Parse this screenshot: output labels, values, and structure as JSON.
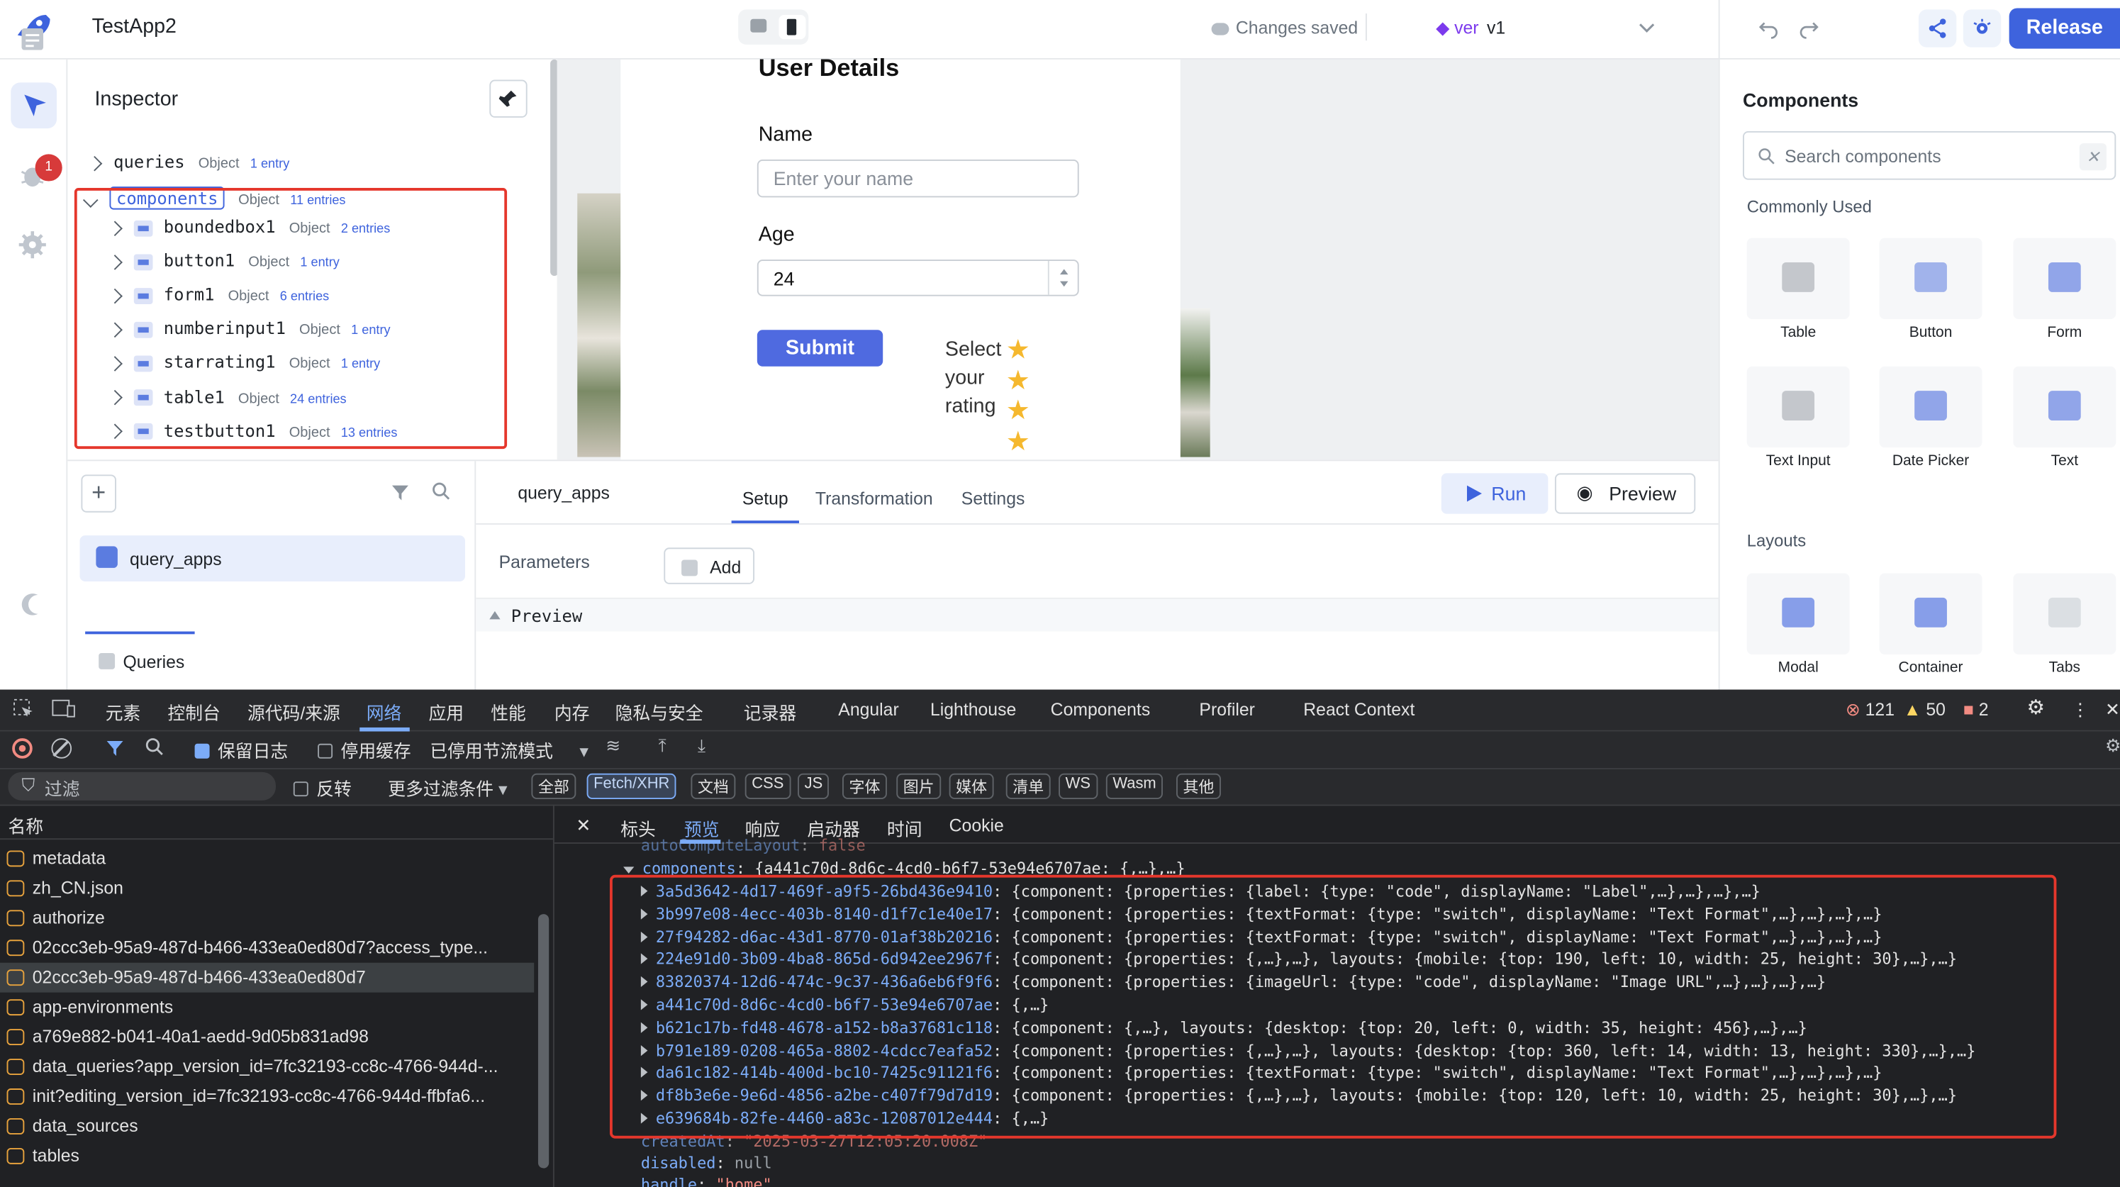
{
  "app": {
    "name": "TestApp2",
    "saved": "Changes saved",
    "version_label": "ver",
    "version": "v1",
    "release": "Release"
  },
  "rail": {
    "badge": "1"
  },
  "inspector": {
    "title": "Inspector",
    "queries": {
      "key": "queries",
      "type": "Object",
      "entries": "1 entry"
    },
    "components": {
      "key": "components",
      "type": "Object",
      "entries": "11 entries"
    },
    "items": [
      {
        "key": "boundedbox1",
        "type": "Object",
        "entries": "2 entries"
      },
      {
        "key": "button1",
        "type": "Object",
        "entries": "1 entry"
      },
      {
        "key": "form1",
        "type": "Object",
        "entries": "6 entries"
      },
      {
        "key": "numberinput1",
        "type": "Object",
        "entries": "1 entry"
      },
      {
        "key": "starrating1",
        "type": "Object",
        "entries": "1 entry"
      },
      {
        "key": "table1",
        "type": "Object",
        "entries": "24 entries"
      },
      {
        "key": "testbutton1",
        "type": "Object",
        "entries": "13 entries"
      }
    ]
  },
  "canvas": {
    "title": "User Details",
    "name_label": "Name",
    "name_placeholder": "Enter your name",
    "age_label": "Age",
    "age_value": "24",
    "submit": "Submit",
    "rating_label": "Select your rating",
    "rating_stars": 4
  },
  "query": {
    "item": "query_apps",
    "name": "query_apps",
    "tabs": [
      "Setup",
      "Transformation",
      "Settings"
    ],
    "run": "Run",
    "preview": "Preview",
    "parameters": "Parameters",
    "add": "Add",
    "preview_section": "Preview",
    "bottom_tab": "Queries"
  },
  "components_panel": {
    "title": "Components",
    "search_placeholder": "Search components",
    "commonly_used": "Commonly Used",
    "common": [
      "Table",
      "Button",
      "Form",
      "Text Input",
      "Date Picker",
      "Text"
    ],
    "layouts_title": "Layouts",
    "layouts": [
      "Modal",
      "Container",
      "Tabs"
    ]
  },
  "devtools": {
    "tabs": [
      "元素",
      "控制台",
      "源代码/来源",
      "网络",
      "应用",
      "性能",
      "内存",
      "隐私与安全",
      "记录器",
      "Angular",
      "Lighthouse",
      "Components",
      "Profiler",
      "React Context"
    ],
    "errors": "121",
    "warnings": "50",
    "issues": "2",
    "toolbar": {
      "preserve_log": "保留日志",
      "disable_cache": "停用缓存",
      "throttle": "已停用节流模式"
    },
    "filter": {
      "placeholder": "过滤",
      "invert": "反转",
      "more": "更多过滤条件"
    },
    "chips": [
      "全部",
      "Fetch/XHR",
      "文档",
      "CSS",
      "JS",
      "字体",
      "图片",
      "媒体",
      "清单",
      "WS",
      "Wasm",
      "其他"
    ],
    "list_header": "名称",
    "requests": [
      "metadata",
      "zh_CN.json",
      "authorize",
      "02ccc3eb-95a9-487d-b466-433ea0ed80d7?access_type...",
      "02ccc3eb-95a9-487d-b466-433ea0ed80d7",
      "app-environments",
      "a769e882-b041-40a1-aedd-9d05b831ad98",
      "data_queries?app_version_id=7fc32193-cc8c-4766-944d-...",
      "init?editing_version_id=7fc32193-cc8c-4766-944d-ffbfa6...",
      "data_sources",
      "tables"
    ],
    "detail_tabs": [
      "标头",
      "预览",
      "响应",
      "启动器",
      "时间",
      "Cookie"
    ],
    "json": {
      "top_key": "autoComputeLayout",
      "top_val": "false",
      "components_key": "components",
      "components_val": "{a441c70d-8d6c-4cd0-b6f7-53e94e6707ae: {,…},…}",
      "rows": [
        {
          "k": "3a5d3642-4d17-469f-a9f5-26bd436e9410",
          "v": "{component: {properties: {label: {type: \"code\", displayName: \"Label\",…},…},…},…}"
        },
        {
          "k": "3b997e08-4ecc-403b-8140-d1f7c1e40e17",
          "v": "{component: {properties: {textFormat: {type: \"switch\", displayName: \"Text Format\",…},…},…},…}"
        },
        {
          "k": "27f94282-d6ac-43d1-8770-01af38b20216",
          "v": "{component: {properties: {textFormat: {type: \"switch\", displayName: \"Text Format\",…},…},…},…}"
        },
        {
          "k": "224e91d0-3b09-4ba8-865d-6d942ee2967f",
          "v": "{component: {properties: {,…},…}, layouts: {mobile: {top: 190, left: 10, width: 25, height: 30},…},…}"
        },
        {
          "k": "83820374-12d6-474c-9c37-436a6eb6f9f6",
          "v": "{component: {properties: {imageUrl: {type: \"code\", displayName: \"Image URL\",…},…},…},…}"
        },
        {
          "k": "a441c70d-8d6c-4cd0-b6f7-53e94e6707ae",
          "v": "{,…}"
        },
        {
          "k": "b621c17b-fd48-4678-a152-b8a37681c118",
          "v": "{component: {,…}, layouts: {desktop: {top: 20, left: 0, width: 35, height: 456},…},…}"
        },
        {
          "k": "b791e189-0208-465a-8802-4cdcc7eafa52",
          "v": "{component: {properties: {,…},…}, layouts: {desktop: {top: 360, left: 14, width: 13, height: 330},…},…}"
        },
        {
          "k": "da61c182-414b-400d-bc10-7425c91121f6",
          "v": "{component: {properties: {textFormat: {type: \"switch\", displayName: \"Text Format\",…},…},…},…}"
        },
        {
          "k": "df8b3e6e-9e6d-4856-a2be-c407f79d7d19",
          "v": "{component: {properties: {,…},…}, layouts: {mobile: {top: 120, left: 10, width: 25, height: 30},…},…}"
        },
        {
          "k": "e639684b-82fe-4460-a83c-12087012e444",
          "v": "{,…}"
        }
      ],
      "created_key": "createdAt",
      "created_val": "\"2025-03-27T12:05:20.008Z\"",
      "disabled_key": "disabled",
      "disabled_val": "null",
      "handle_key": "handle",
      "handle_val": "\"home\""
    }
  }
}
